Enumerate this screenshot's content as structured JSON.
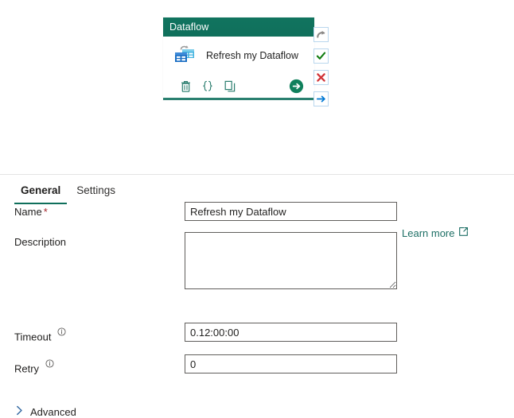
{
  "canvas": {
    "activity_card": {
      "header_title": "Dataflow",
      "activity_name": "Refresh my Dataflow",
      "header_color": "#0f6f5b",
      "accent_color": "#2a8070",
      "icon_name": "dataflow-icon",
      "toolbar": [
        {
          "icon": "delete-icon",
          "label": "Delete"
        },
        {
          "icon": "code-icon",
          "label": "Code"
        },
        {
          "icon": "duplicate-icon",
          "label": "Clone"
        }
      ],
      "run_button": {
        "icon": "green-arrow-run-icon",
        "label": "Run",
        "color": "#107c41"
      }
    },
    "status_rail": [
      {
        "icon": "skipped-icon",
        "label": "Skipped",
        "color": "#8a8886"
      },
      {
        "icon": "success-icon",
        "label": "Succeeded",
        "color": "#107c10"
      },
      {
        "icon": "failure-icon",
        "label": "Failed",
        "color": "#d13438"
      },
      {
        "icon": "completion-icon",
        "label": "Completion",
        "color": "#0078d4"
      }
    ]
  },
  "panel": {
    "tabs": [
      {
        "label": "General",
        "active": true
      },
      {
        "label": "Settings",
        "active": false
      }
    ],
    "fields": {
      "name": {
        "label": "Name",
        "required_marker": "*",
        "value": "Refresh my Dataflow",
        "placeholder": ""
      },
      "description": {
        "label": "Description",
        "value": "",
        "placeholder": ""
      },
      "timeout": {
        "label": "Timeout",
        "info_icon": "info-icon",
        "value": "0.12:00:00",
        "placeholder": ""
      },
      "retry": {
        "label": "Retry",
        "info_icon": "info-icon",
        "value": "0",
        "placeholder": ""
      }
    },
    "learn_more": {
      "label": "Learn more",
      "icon": "external-link-icon",
      "color": "#1d6f65"
    },
    "advanced": {
      "label": "Advanced",
      "icon": "chevron-right-icon",
      "expanded": false
    }
  }
}
